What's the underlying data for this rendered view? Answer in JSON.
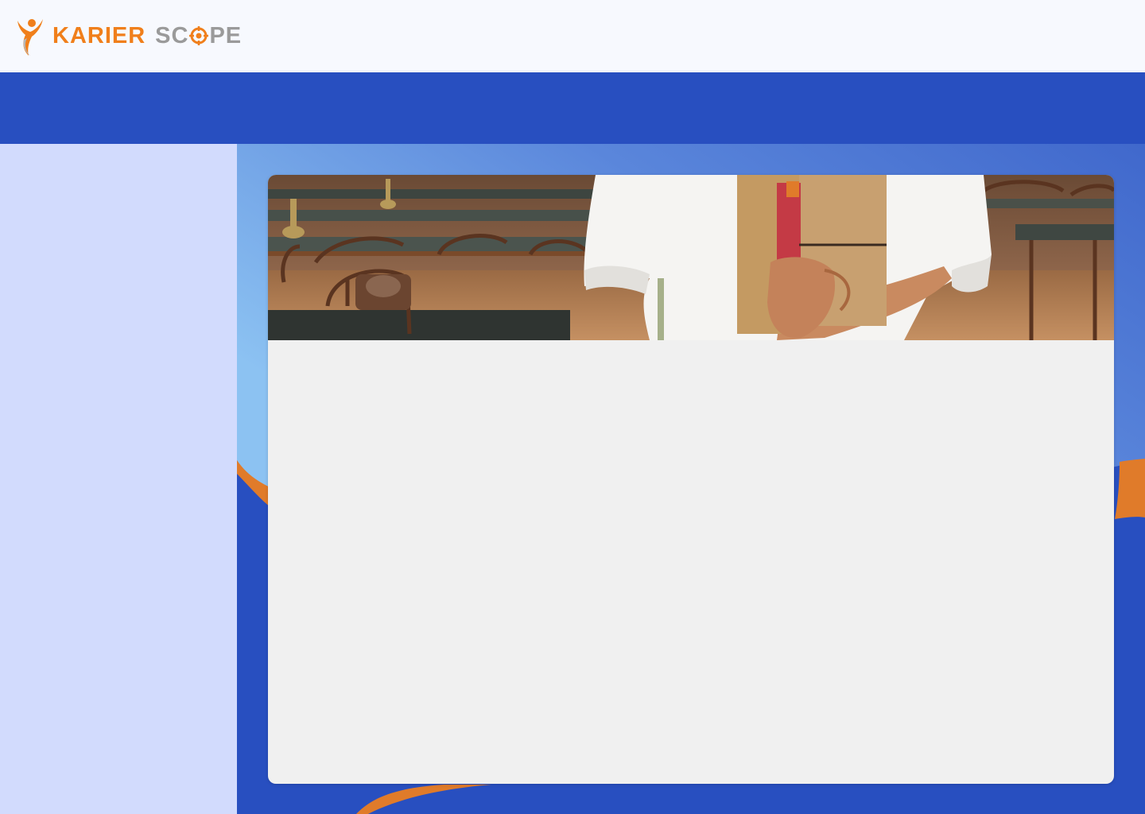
{
  "brand": {
    "name_part1": "KARIER",
    "name_part2_before": "SC",
    "name_part2_after": "PE",
    "color_primary": "#f07f1b",
    "color_secondary": "#9a9a9a",
    "logo_icon": "person-flame-logo-icon",
    "target_icon": "target-icon"
  },
  "theme": {
    "navbar_color": "#284fc0",
    "sidebar_color": "#d2dbfd",
    "accent_orange": "#e07b2a"
  },
  "banner": {
    "image": "library-student-holding-books-photo"
  }
}
